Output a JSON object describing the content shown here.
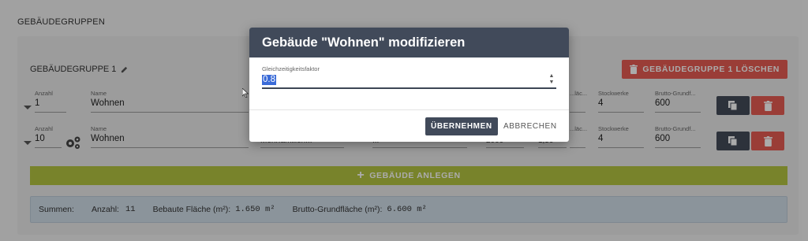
{
  "page": {
    "title": "GEBÄUDEGRUPPEN"
  },
  "group": {
    "title": "GEBÄUDEGRUPPE 1",
    "delete_label": "GEBÄUDEGRUPPE 1 LÖSCHEN",
    "add_building_label": "GEBÄUDE ANLEGEN",
    "rows": [
      {
        "count_label": "Anzahl",
        "count": "1",
        "name_label": "Name",
        "name": "Wohnen",
        "floors_label": "Stockwerke",
        "floors": "4",
        "gross_label": "Brutto-Grundf...",
        "gross": "600",
        "partial_label": "...läc..."
      },
      {
        "count_label": "Anzahl",
        "count": "10",
        "name_label": "Name",
        "name": "Wohnen",
        "type_value": "Mehrfamilien...",
        "c3": "...",
        "c4": "2000",
        "c5": "1,50",
        "floors_label": "Stockwerke",
        "floors": "4",
        "gross_label": "Brutto-Grundf...",
        "gross": "600",
        "partial_label": "...läc..."
      }
    ]
  },
  "summary": {
    "label": "Summen:",
    "count_label": "Anzahl:",
    "count": "11",
    "built_area_label": "Bebaute Fläche (m²):",
    "built_area": "1.650 m²",
    "gross_area_label": "Brutto-Grundfläche (m²):",
    "gross_area": "6.600 m²"
  },
  "dialog": {
    "title": "Gebäude \"Wohnen\" modifizieren",
    "field_label": "Gleichzeitigkeitsfaktor",
    "field_value": "0.8",
    "apply_label": "ÜBERNEHMEN",
    "cancel_label": "ABBRECHEN"
  },
  "colors": {
    "primary": "#414a5a",
    "danger": "#e65b52",
    "accent_green": "#b3c441",
    "summary_bg": "#cfdde8"
  }
}
